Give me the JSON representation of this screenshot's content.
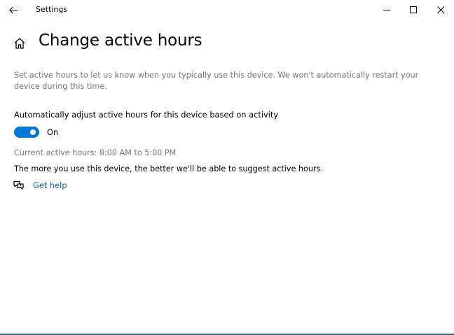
{
  "window": {
    "title": "Settings",
    "icons": {
      "back": "arrow-left-icon",
      "minimize": "minimize-icon",
      "maximize": "maximize-icon",
      "close": "close-icon"
    }
  },
  "header": {
    "home_icon": "home-icon",
    "title": "Change active hours"
  },
  "main": {
    "description": "Set active hours to let us know when you typically use this device. We won't automatically restart your device during this time.",
    "auto_adjust": {
      "label": "Automatically adjust active hours for this device based on activity",
      "toggle_on": true,
      "state_label": "On"
    },
    "current_hours": "Current active hours: 8:00 AM to 5:00 PM",
    "suggestion": "The more you use this device, the better we'll be able to suggest active hours.",
    "help": {
      "icon": "chat-help-icon",
      "label": "Get help"
    }
  },
  "colors": {
    "accent": "#0078d7",
    "link": "#0063b1",
    "secondary_text": "#767676"
  }
}
